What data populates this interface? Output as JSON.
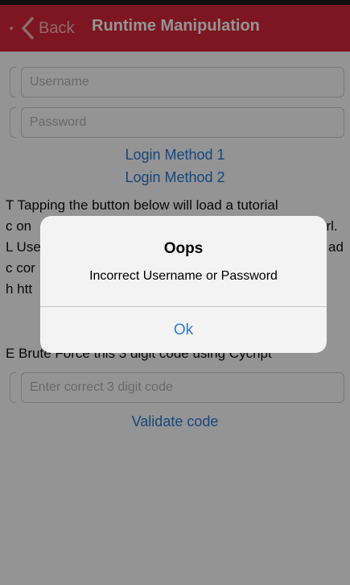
{
  "nav": {
    "back_label": "Back",
    "title": "Runtime Manipulation"
  },
  "login": {
    "username_placeholder": "Username",
    "password_placeholder": "Password",
    "method1_label": "Login Method 1",
    "method2_label": "Login Method 2"
  },
  "tutorial": {
    "line1": "T Tapping the button below will load a tutorial",
    "line2": "c on",
    "line2_tail": "url.",
    "line3": "L Use",
    "line3_tail": "ad",
    "line4": "c cor",
    "line5": "h htt"
  },
  "brute": {
    "line": "E Brute Force this 3 digit code using Cycript",
    "code_placeholder": "Enter correct 3 digit code",
    "validate_label": "Validate code"
  },
  "alert": {
    "title": "Oops",
    "message": "Incorrect Username or Password",
    "ok_label": "Ok"
  },
  "colors": {
    "nav_background": "#d8263a",
    "link": "#2a7bd6"
  }
}
